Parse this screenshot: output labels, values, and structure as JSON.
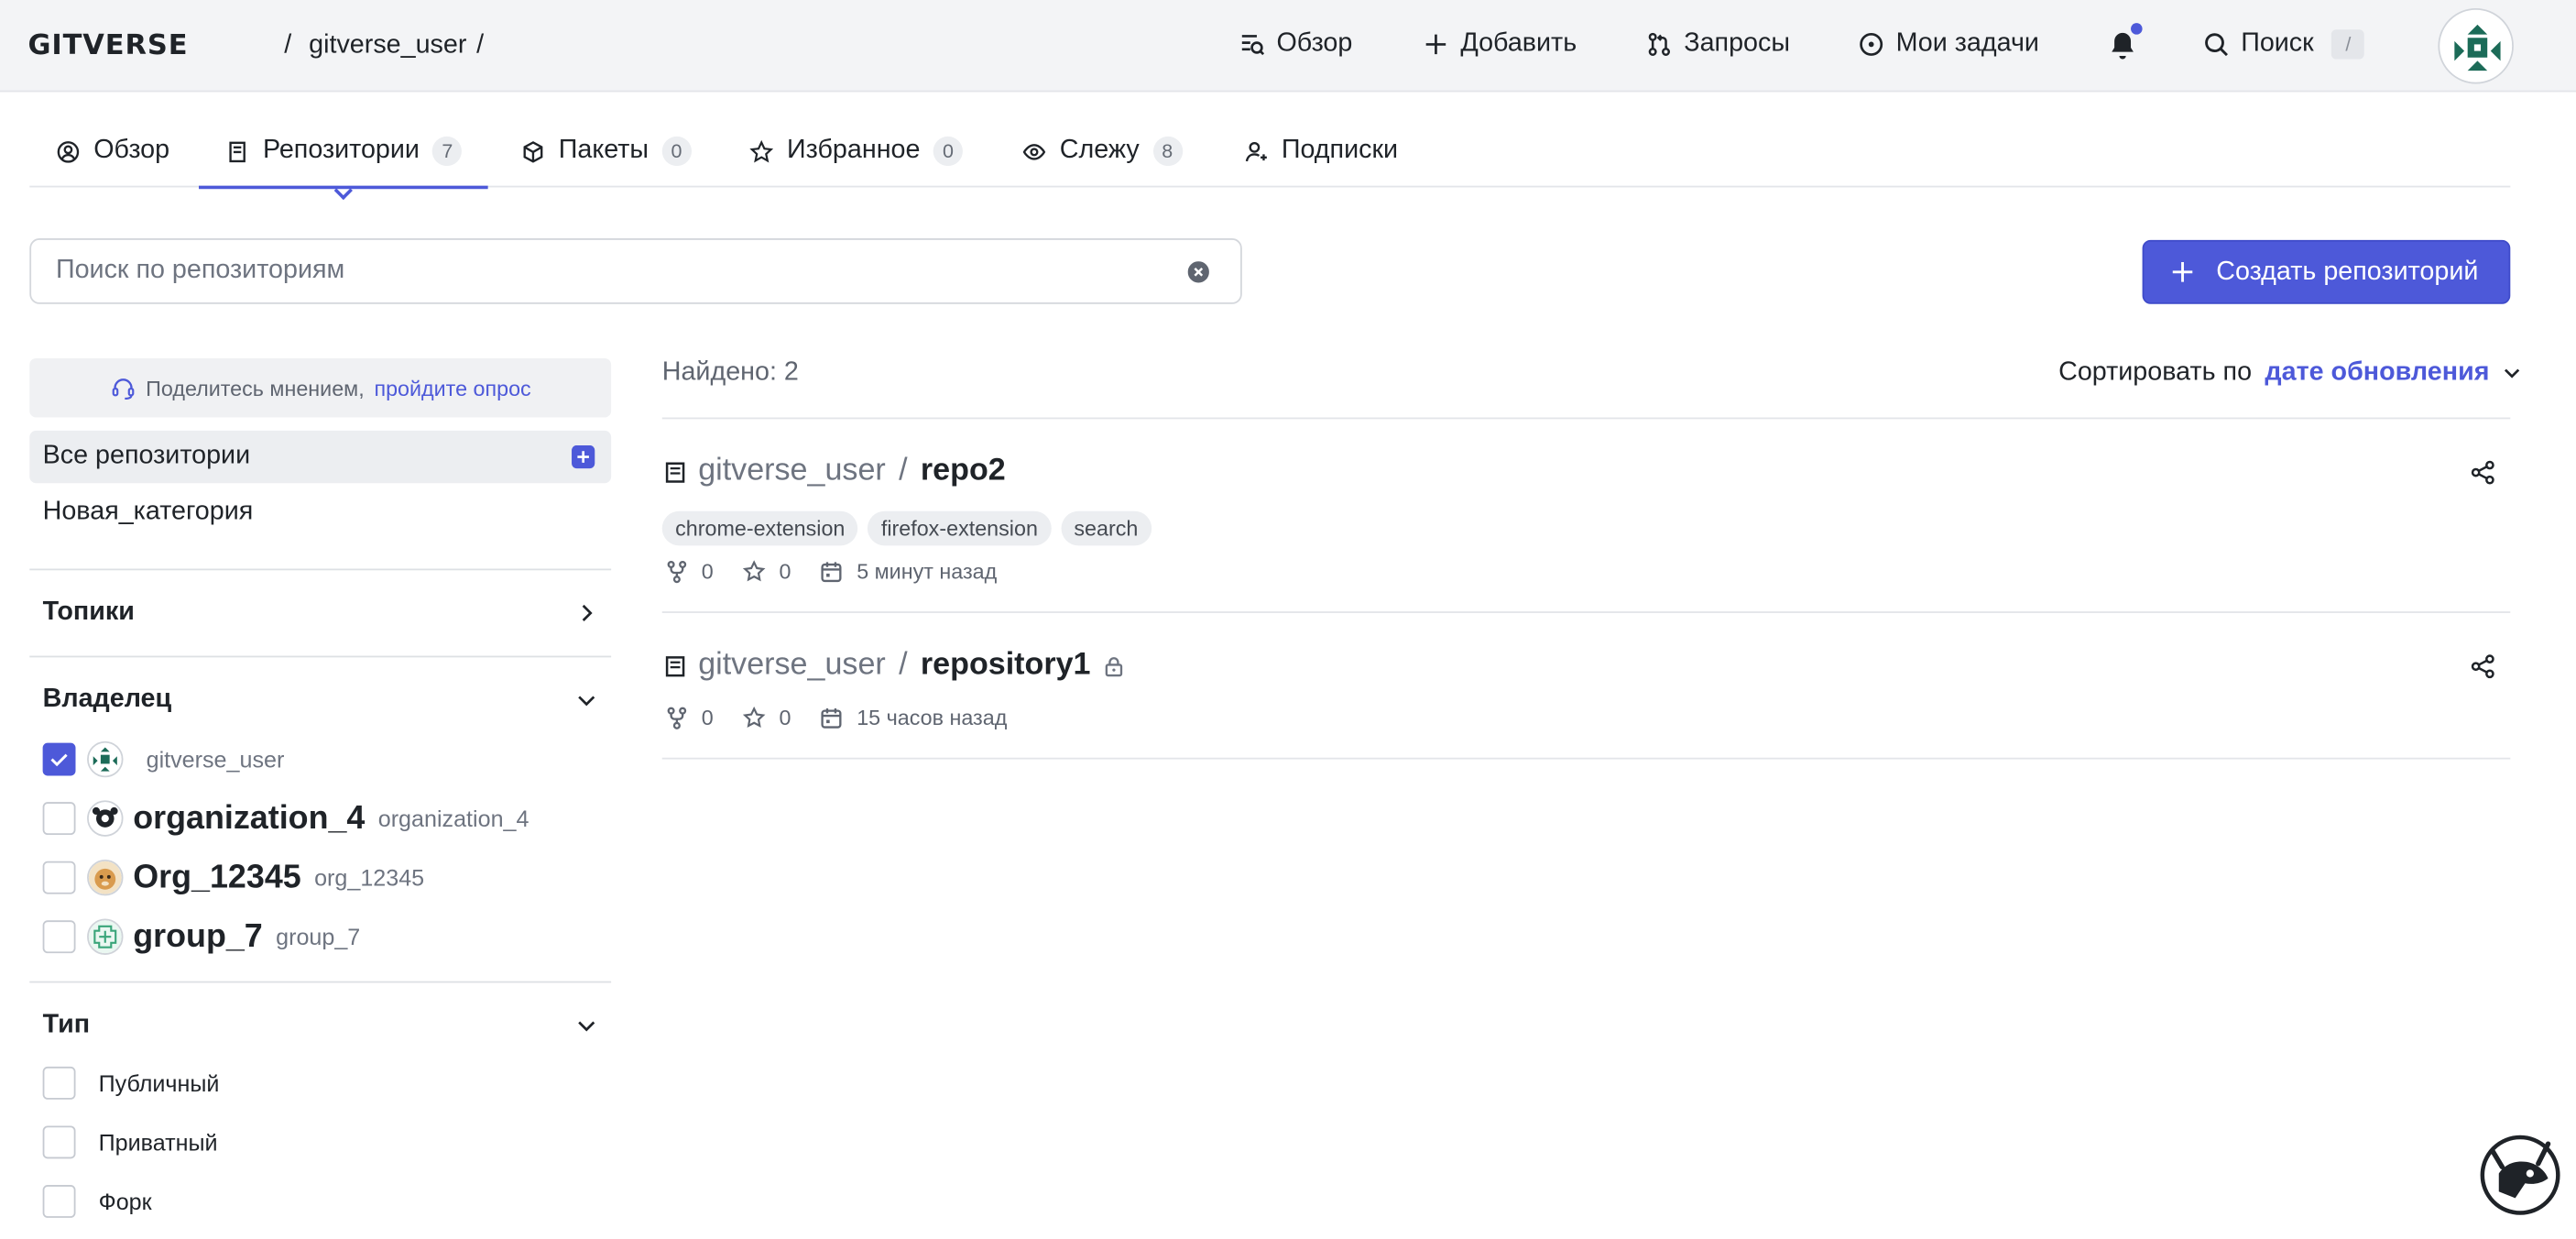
{
  "header": {
    "logo_text": "GITVERSE",
    "breadcrumb_sep": "/",
    "breadcrumb_user": "gitverse_user",
    "nav": {
      "overview": "Обзор",
      "add": "Добавить",
      "requests": "Запросы",
      "tasks": "Мои задачи",
      "search": "Поиск",
      "search_kbd": "/"
    }
  },
  "tabs": [
    {
      "label": "Обзор",
      "icon": "user-circle-icon"
    },
    {
      "label": "Репозитории",
      "count": "7",
      "icon": "book-icon",
      "active": true
    },
    {
      "label": "Пакеты",
      "count": "0",
      "icon": "package-icon"
    },
    {
      "label": "Избранное",
      "count": "0",
      "icon": "star-icon"
    },
    {
      "label": "Слежу",
      "count": "8",
      "icon": "eye-icon"
    },
    {
      "label": "Подписки",
      "icon": "person-icon"
    }
  ],
  "search": {
    "placeholder": "Поиск по репозиториям",
    "value": ""
  },
  "create_button": "Создать репозиторий",
  "sidebar": {
    "feedback_text": "Поделитесь мнением,",
    "feedback_link": "пройдите опрос",
    "categories": [
      "Все репозитории",
      "Новая_категория"
    ],
    "topics_title": "Топики",
    "owner_title": "Владелец",
    "owners": [
      {
        "name": "",
        "login": "gitverse_user",
        "checked": true
      },
      {
        "name": "organization_4",
        "login": "organization_4",
        "checked": false
      },
      {
        "name": "Org_12345",
        "login": "org_12345",
        "checked": false
      },
      {
        "name": "group_7",
        "login": "group_7",
        "checked": false
      }
    ],
    "type_title": "Тип",
    "types": [
      "Публичный",
      "Приватный",
      "Форк"
    ]
  },
  "results": {
    "found": "Найдено: 2",
    "sort_label": "Сортировать по",
    "sort_value": "дате обновления",
    "repos": [
      {
        "owner": "gitverse_user",
        "sep": "/",
        "name": "repo2",
        "private": false,
        "topics": [
          "chrome-extension",
          "firefox-extension",
          "search"
        ],
        "forks": "0",
        "stars": "0",
        "updated": "5 минут назад"
      },
      {
        "owner": "gitverse_user",
        "sep": "/",
        "name": "repository1",
        "private": true,
        "topics": [],
        "forks": "0",
        "stars": "0",
        "updated": "15 часов назад"
      }
    ]
  },
  "colors": {
    "accent": "#4d59d9",
    "header_bg": "#f3f4f6",
    "muted": "#6e7480"
  }
}
